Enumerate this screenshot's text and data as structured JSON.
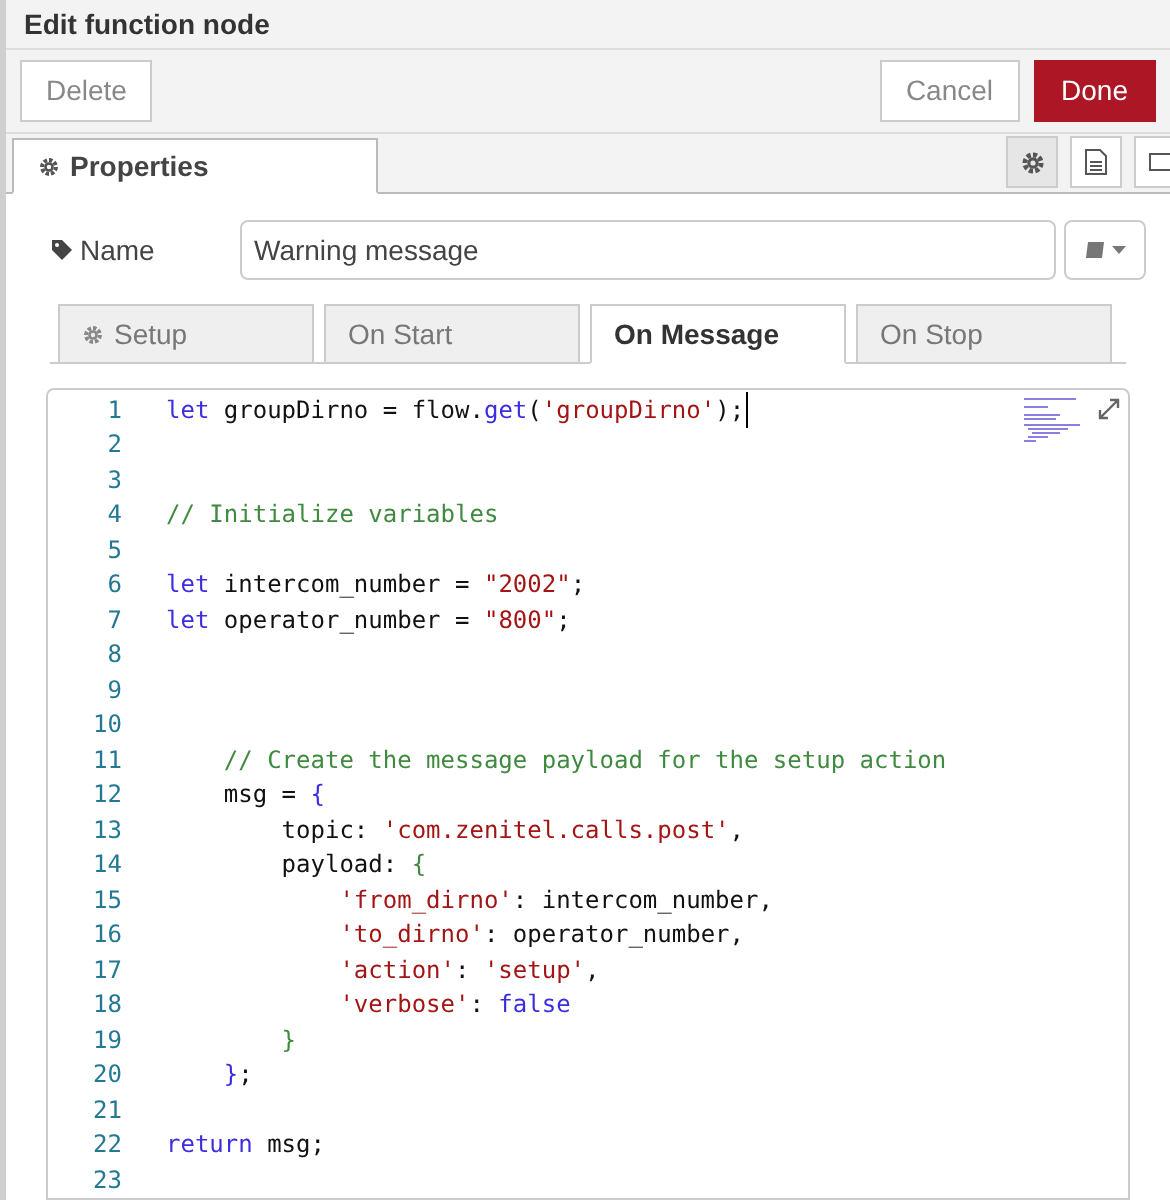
{
  "dialog": {
    "title": "Edit function node"
  },
  "buttons": [
    {
      "label": "Delete",
      "kind": "plain"
    },
    {
      "label": "Cancel",
      "kind": "plain"
    },
    {
      "label": "Done",
      "kind": "primary"
    }
  ],
  "tabs": [
    {
      "label": "Properties",
      "selected": true
    }
  ],
  "name_field": {
    "label": "Name",
    "value": "Warning message"
  },
  "subtabs": [
    {
      "label": "Setup",
      "selected": false,
      "kind": "gear"
    },
    {
      "label": "On Start",
      "selected": false,
      "kind": "plain"
    },
    {
      "label": "On Message",
      "selected": true,
      "kind": "plain"
    },
    {
      "label": "On Stop",
      "selected": false,
      "kind": "plain"
    }
  ],
  "editor": {
    "lines": [
      {
        "number": "1",
        "tokens": [
          {
            "kind": "keyword",
            "text": "let"
          },
          {
            "kind": "plain",
            "text": " groupDirno = flow."
          },
          {
            "kind": "keyword",
            "text": "get"
          },
          {
            "kind": "plain",
            "text": "("
          },
          {
            "kind": "string",
            "text": "'groupDirno'"
          },
          {
            "kind": "plain",
            "text": ");"
          }
        ]
      },
      {
        "number": "2"
      },
      {
        "number": "3"
      },
      {
        "number": "4",
        "tokens": [
          {
            "kind": "comment",
            "text": "// Initialize variables"
          }
        ]
      },
      {
        "number": "5"
      },
      {
        "number": "6",
        "tokens": [
          {
            "kind": "keyword",
            "text": "let"
          },
          {
            "kind": "plain",
            "text": " intercom_number = "
          },
          {
            "kind": "string",
            "text": "\"2002\""
          },
          {
            "kind": "plain",
            "text": ";"
          }
        ]
      },
      {
        "number": "7",
        "tokens": [
          {
            "kind": "keyword",
            "text": "let"
          },
          {
            "kind": "plain",
            "text": " operator_number = "
          },
          {
            "kind": "string",
            "text": "\"800\""
          },
          {
            "kind": "plain",
            "text": ";"
          }
        ]
      },
      {
        "number": "8"
      },
      {
        "number": "9"
      },
      {
        "number": "10"
      },
      {
        "number": "11",
        "tokens": [
          {
            "kind": "comment",
            "text": "    // Create the message payload for the setup action"
          }
        ]
      },
      {
        "number": "12",
        "tokens": [
          {
            "kind": "plain",
            "text": "    msg = "
          },
          {
            "kind": "bracket1",
            "text": "{"
          }
        ]
      },
      {
        "number": "13",
        "tokens": [
          {
            "kind": "plain",
            "text": "        topic: "
          },
          {
            "kind": "string",
            "text": "'com.zenitel.calls.post'"
          },
          {
            "kind": "plain",
            "text": ","
          }
        ]
      },
      {
        "number": "14",
        "tokens": [
          {
            "kind": "plain",
            "text": "        payload: "
          },
          {
            "kind": "bracket2",
            "text": "{"
          }
        ]
      },
      {
        "number": "15",
        "tokens": [
          {
            "kind": "string",
            "text": "            'from_dirno'"
          },
          {
            "kind": "plain",
            "text": ": intercom_number,"
          }
        ]
      },
      {
        "number": "16",
        "tokens": [
          {
            "kind": "string",
            "text": "            'to_dirno'"
          },
          {
            "kind": "plain",
            "text": ": operator_number,"
          }
        ]
      },
      {
        "number": "17",
        "tokens": [
          {
            "kind": "string",
            "text": "            'action'"
          },
          {
            "kind": "plain",
            "text": ": "
          },
          {
            "kind": "string",
            "text": "'setup'"
          },
          {
            "kind": "plain",
            "text": ","
          }
        ]
      },
      {
        "number": "18",
        "tokens": [
          {
            "kind": "string",
            "text": "            'verbose'"
          },
          {
            "kind": "plain",
            "text": ": "
          },
          {
            "kind": "keyword",
            "text": "false"
          }
        ]
      },
      {
        "number": "19",
        "tokens": [
          {
            "kind": "bracket2",
            "text": "        }"
          }
        ]
      },
      {
        "number": "20",
        "tokens": [
          {
            "kind": "bracket1",
            "text": "    }"
          },
          {
            "kind": "plain",
            "text": ";"
          }
        ]
      },
      {
        "number": "21"
      },
      {
        "number": "22",
        "tokens": [
          {
            "kind": "keyword",
            "text": "return"
          },
          {
            "kind": "plain",
            "text": " msg;"
          }
        ]
      },
      {
        "number": "23"
      }
    ]
  }
}
